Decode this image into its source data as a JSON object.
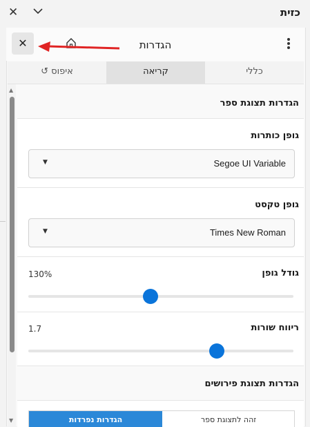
{
  "window": {
    "title": "כזית",
    "close_glyph": "✕",
    "collapse_glyph": "chevron-down-icon"
  },
  "header": {
    "title": "הגדרות",
    "close_glyph": "✕",
    "home_icon": "home-icon",
    "more_icon": "more-vertical-icon"
  },
  "tabs": [
    {
      "label": "כללי",
      "active": false
    },
    {
      "label": "קריאה",
      "active": true
    },
    {
      "label": "↺ איפוס",
      "active": false
    }
  ],
  "book_display": {
    "title": "הגדרות תצוגת ספר",
    "heading_font": {
      "label": "גופן כותרות",
      "value": "Segoe UI Variable"
    },
    "text_font": {
      "label": "גופן טקסט",
      "value": "Times New Roman"
    },
    "font_size": {
      "label": "גודל גופן",
      "value_text": "130%",
      "fraction": 0.46
    },
    "line_spacing": {
      "label": "ריווח שורות",
      "value_text": "1.7",
      "fraction": 0.71
    }
  },
  "commentary_display": {
    "title": "הגדרות תצוגת פירושים",
    "segments": [
      {
        "label": "הגדרות נפרדות",
        "selected": true
      },
      {
        "label": "זהה לתצוגת ספר",
        "selected": false
      }
    ]
  },
  "colors": {
    "accent": "#0a74da",
    "segment_selected": "#2b88d8",
    "annotation_arrow": "#e02424"
  }
}
